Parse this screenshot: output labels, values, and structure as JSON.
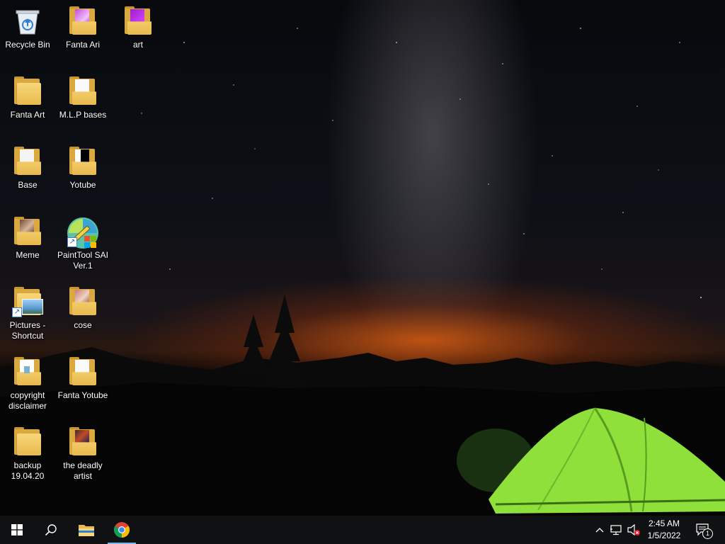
{
  "desktop": {
    "icons": [
      {
        "label": "Recycle Bin",
        "icon": "recycle-bin-icon"
      },
      {
        "label": "Fanta Ari",
        "icon": "folder-icon"
      },
      {
        "label": "art",
        "icon": "folder-icon"
      },
      {
        "label": "Fanta Art",
        "icon": "folder-icon"
      },
      {
        "label": "M.L.P bases",
        "icon": "folder-icon"
      },
      {
        "label": "Base",
        "icon": "folder-icon"
      },
      {
        "label": "Yotube",
        "icon": "folder-icon"
      },
      {
        "label": "Meme",
        "icon": "folder-icon"
      },
      {
        "label": "PaintTool SAI Ver.1",
        "icon": "painttool-sai-icon"
      },
      {
        "label": "Pictures - Shortcut",
        "icon": "folder-shortcut-icon"
      },
      {
        "label": "cose",
        "icon": "folder-icon"
      },
      {
        "label": "copyright disclaimer",
        "icon": "text-document-icon"
      },
      {
        "label": "Fanta Yotube",
        "icon": "folder-icon"
      },
      {
        "label": "backup 19.04.20",
        "icon": "folder-icon"
      },
      {
        "label": "the deadly artist",
        "icon": "folder-icon"
      }
    ]
  },
  "taskbar": {
    "start": "windows-start-icon",
    "search": "search-icon",
    "pinned": [
      "file-explorer-icon",
      "chrome-icon"
    ],
    "tray": {
      "chevron": "chevron-up-icon",
      "network": "network-icon",
      "volume": "volume-muted-icon",
      "time": "2:45 AM",
      "date": "1/5/2022",
      "notifications_count": "1"
    }
  },
  "colors": {
    "taskbar": "#101113",
    "accent": "#76b9ed",
    "folder": "#e8b94d",
    "tent": "#8fe03a"
  }
}
